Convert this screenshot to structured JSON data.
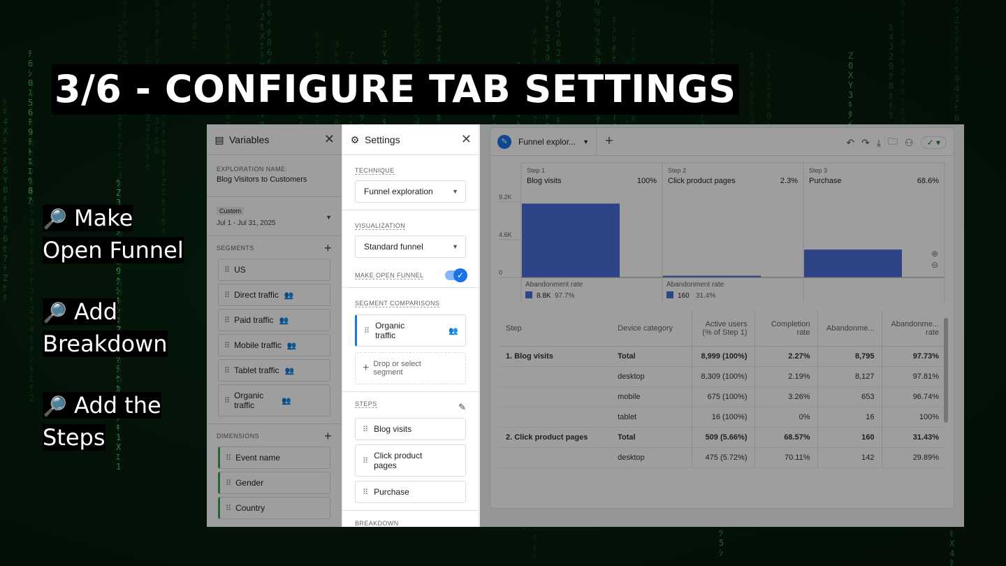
{
  "slide": {
    "title": "3/6 - CONFIGURE TAB SETTINGS",
    "bullets": [
      {
        "icon": "magnifier-icon",
        "lines": [
          "Make",
          "Open Funnel"
        ]
      },
      {
        "icon": "magnifier-icon",
        "lines": [
          "Add",
          "Breakdown"
        ]
      },
      {
        "icon": "magnifier-icon",
        "lines": [
          "Add the",
          "Steps"
        ]
      }
    ]
  },
  "variables": {
    "title": "Variables",
    "exploration_label": "EXPLORATION NAME:",
    "exploration_name": "Blog Visitors to Customers",
    "date_tag": "Custom",
    "date_range": "Jul 1 - Jul 31, 2025",
    "segments_label": "SEGMENTS",
    "segments": [
      "US",
      "Direct traffic",
      "Paid traffic",
      "Mobile traffic",
      "Tablet traffic",
      "Organic traffic"
    ],
    "dimensions_label": "DIMENSIONS",
    "dimensions": [
      "Event name",
      "Gender",
      "Country"
    ]
  },
  "settings": {
    "title": "Settings",
    "technique_label": "TECHNIQUE",
    "technique_value": "Funnel exploration",
    "visualization_label": "VISUALIZATION",
    "visualization_value": "Standard funnel",
    "open_funnel_label": "MAKE OPEN FUNNEL",
    "open_funnel_on": true,
    "segment_comparisons_label": "SEGMENT COMPARISONS",
    "segment_comparison": "Organic traffic",
    "drop_placeholder": "Drop or select segment",
    "steps_label": "STEPS",
    "steps": [
      "Blog visits",
      "Click product pages",
      "Purchase"
    ],
    "breakdown_label": "BREAKDOWN"
  },
  "report": {
    "tab_label": "Funnel explor...",
    "chart_data": {
      "type": "bar",
      "steps": [
        {
          "step": "Step 1",
          "name": "Blog visits",
          "pct": "100%",
          "value": 8999
        },
        {
          "step": "Step 2",
          "name": "Click product pages",
          "pct": "2.3%",
          "value": 204
        },
        {
          "step": "Step 3",
          "name": "Purchase",
          "pct": "68.6%",
          "value": 3400
        }
      ],
      "y_ticks": [
        "9.2K",
        "4.6K",
        "0"
      ],
      "ylim": [
        0,
        9200
      ],
      "abandonment": [
        {
          "label": "Abandonment rate",
          "count": "8.8K",
          "rate": "97.7%"
        },
        {
          "label": "Abandonment rate",
          "count": "160",
          "rate": "31.4%"
        }
      ],
      "bar_color": "#4a6fd8"
    },
    "table": {
      "headers": [
        "Step",
        "Device category",
        "Active users (% of Step 1)",
        "Completion rate",
        "Abandonme...",
        "Abandonme... rate"
      ],
      "rows": [
        {
          "step": "1. Blog visits",
          "cat": "Total",
          "users": "8,999 (100%)",
          "comp": "2.27%",
          "aband": "8,795",
          "rate": "97.73%",
          "bold": true,
          "group": true
        },
        {
          "step": "",
          "cat": "desktop",
          "users": "8,309 (100%)",
          "comp": "2.19%",
          "aband": "8,127",
          "rate": "97.81%"
        },
        {
          "step": "",
          "cat": "mobile",
          "users": "675 (100%)",
          "comp": "3.26%",
          "aband": "653",
          "rate": "96.74%"
        },
        {
          "step": "",
          "cat": "tablet",
          "users": "16 (100%)",
          "comp": "0%",
          "aband": "16",
          "rate": "100%"
        },
        {
          "step": "2. Click product pages",
          "cat": "Total",
          "users": "509 (5.66%)",
          "comp": "68.57%",
          "aband": "160",
          "rate": "31.43%",
          "bold": true,
          "group": true
        },
        {
          "step": "",
          "cat": "desktop",
          "users": "475 (5.72%)",
          "comp": "70.11%",
          "aband": "142",
          "rate": "29.89%"
        }
      ]
    }
  }
}
